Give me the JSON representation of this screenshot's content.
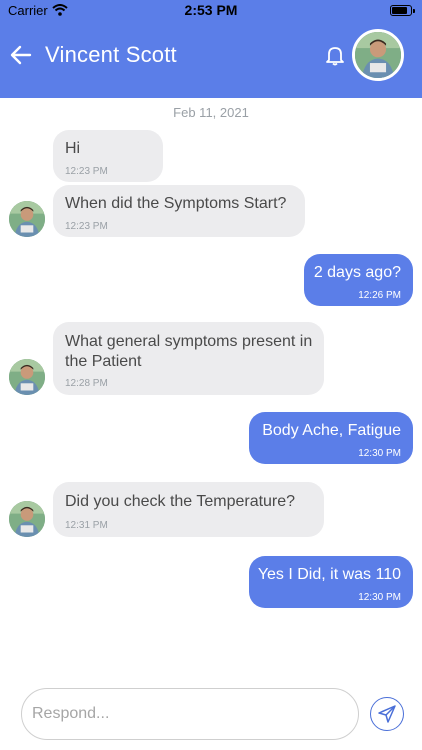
{
  "status_bar": {
    "carrier": "Carrier",
    "time": "2:53 PM"
  },
  "header": {
    "title": "Vincent Scott",
    "back_icon": "arrow-left-icon",
    "bell_icon": "bell-icon"
  },
  "colors": {
    "accent": "#5b7ee8",
    "incoming_bubble": "#ececee",
    "incoming_text": "#4a4a4a",
    "timestamp_gray": "#9aa0a6"
  },
  "date_separator": "Feb 11, 2021",
  "messages": [
    {
      "direction": "incoming",
      "text": "Hi",
      "time": "12:23 PM",
      "show_avatar": false
    },
    {
      "direction": "incoming",
      "text": "When did the Symptoms Start?",
      "time": "12:23 PM",
      "show_avatar": true
    },
    {
      "direction": "outgoing",
      "text": "2 days ago?",
      "time": "12:26 PM"
    },
    {
      "direction": "incoming",
      "text": "What general symptoms present in the Patient",
      "time": "12:28 PM",
      "show_avatar": true
    },
    {
      "direction": "outgoing",
      "text": "Body Ache, Fatigue",
      "time": "12:30 PM"
    },
    {
      "direction": "incoming",
      "text": "Did you check the Temperature?",
      "time": "12:31 PM",
      "show_avatar": true
    },
    {
      "direction": "outgoing",
      "text": "Yes I Did, it was 110",
      "time": "12:30 PM"
    }
  ],
  "composer": {
    "placeholder": "Respond...",
    "value": "",
    "send_icon": "send-icon"
  }
}
